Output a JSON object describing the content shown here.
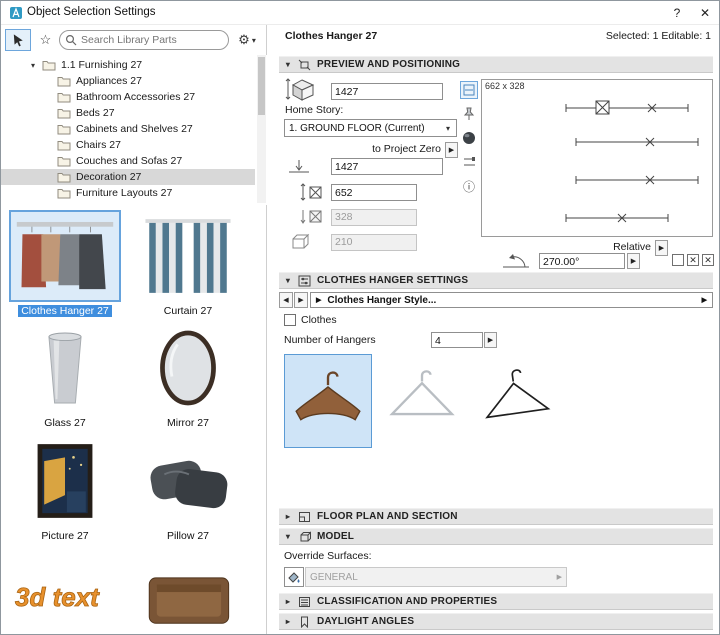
{
  "window": {
    "title": "Object Selection Settings",
    "help": "?",
    "close": "✕"
  },
  "icons": {
    "star": "☆",
    "gear": "⚙",
    "chevron_down": "▾",
    "chevron_right": "▸",
    "arrow_left": "◀",
    "arrow_right": "▶",
    "info": "ⓘ",
    "cross": "✕"
  },
  "library": {
    "search_placeholder": "Search Library Parts",
    "tree_root": "1.1 Furnishing 27",
    "tree_items": [
      "Appliances 27",
      "Bathroom Accessories 27",
      "Beds 27",
      "Cabinets and Shelves 27",
      "Chairs 27",
      "Couches and Sofas 27",
      "Decoration 27",
      "Furniture Layouts 27"
    ],
    "selected_tree_item": "Decoration 27",
    "thumbnails": [
      {
        "label": "Clothes Hanger 27"
      },
      {
        "label": "Curtain 27"
      },
      {
        "label": "Glass 27"
      },
      {
        "label": "Mirror 27"
      },
      {
        "label": "Picture 27"
      },
      {
        "label": "Pillow 27"
      },
      {
        "label": "",
        "image_text": "3d text"
      },
      {
        "label": ""
      }
    ]
  },
  "header": {
    "title": "Clothes Hanger 27",
    "status": "Selected: 1 Editable: 1"
  },
  "preview": {
    "section_title": "PREVIEW AND POSITIONING",
    "top_height": "1427",
    "home_story_label": "Home Story:",
    "home_story_value": "1. GROUND  FLOOR (Current)",
    "to_project_zero": "to Project Zero",
    "elevation": "1427",
    "dim_a": "652",
    "dim_b": "328",
    "dim_c": "210",
    "canvas_size": "662 x 328",
    "relative_label": "Relative",
    "angle": "270.00°"
  },
  "hanger": {
    "section_title": "CLOTHES HANGER SETTINGS",
    "style_value": "Clothes Hanger Style...",
    "clothes_label": "Clothes",
    "hangers_label": "Number of Hangers",
    "hangers_value": "4"
  },
  "sections": {
    "floor_plan": "FLOOR PLAN AND SECTION",
    "model": "MODEL",
    "classification": "CLASSIFICATION AND PROPERTIES",
    "daylight": "DAYLIGHT ANGLES"
  },
  "model": {
    "override_label": "Override Surfaces:",
    "surface_value": "GENERAL"
  }
}
